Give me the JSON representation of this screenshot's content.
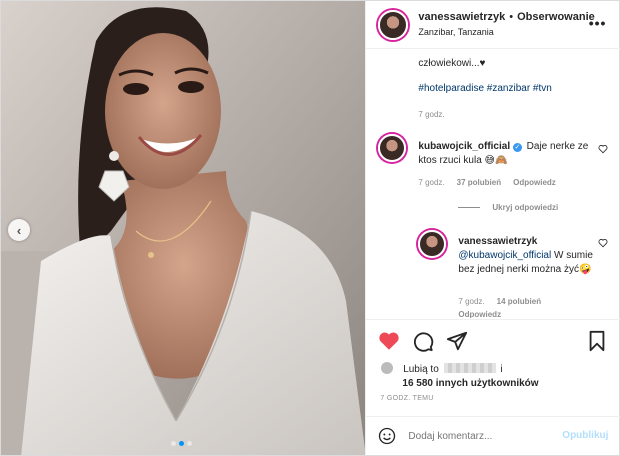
{
  "post": {
    "username": "vanessawietrzyk",
    "dot": "•",
    "follow_label": "Obserwowanie",
    "location": "Zanzibar, Tanzania",
    "more_label": "•••"
  },
  "caption": {
    "text_tail": "człowiekowi...♥",
    "hashtags": "#hotelparadise #zanzibar #tvn",
    "time": "7 godz."
  },
  "comments": [
    {
      "username": "kubawojcik_official",
      "verified_glyph": "✓",
      "text": "Daje nerke ze ktos rzuci kula 😅🙈",
      "time": "7 godz.",
      "likes": "37 polubień",
      "reply": "Odpowiedz"
    }
  ],
  "hide_replies_label": "Ukryj odpowiedzi",
  "reply": {
    "username": "vanessawietrzyk",
    "mention": "@kubawojcik_official",
    "text": "W sumie bez jednej nerki można żyć🤪",
    "time": "7 godz.",
    "likes": "14 polubień",
    "reply": "Odpowiedz"
  },
  "likes": {
    "prefix": "Lubią to",
    "suffix": "i",
    "others": "16 580 innych użytkowników"
  },
  "post_time": "7 GODZ. TEMU",
  "add_comment": {
    "placeholder": "Dodaj komentarz...",
    "publish_label": "Opublikuj"
  },
  "photo": {
    "prev_glyph": "‹",
    "dots": 3,
    "active_dot": 1
  },
  "colors": {
    "like_red": "#ed4956",
    "link_blue": "#00376b",
    "verified_blue": "#3897f0",
    "publish_disabled": "#b2dffc"
  }
}
